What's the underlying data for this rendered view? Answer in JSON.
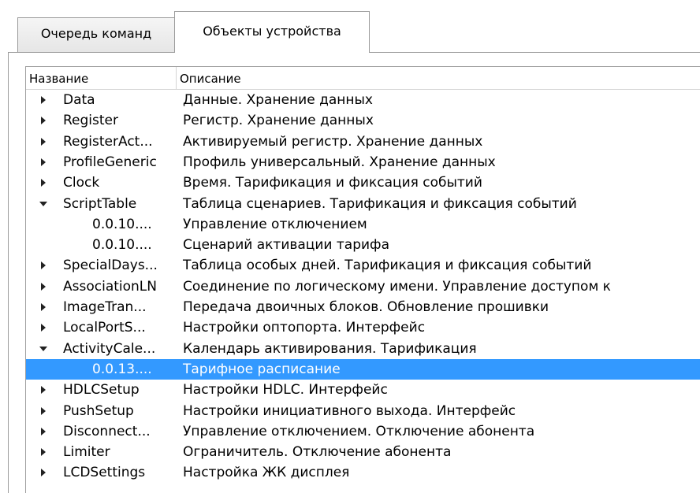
{
  "tabs": {
    "command_queue": "Очередь команд",
    "device_objects": "Объекты устройства"
  },
  "tree": {
    "columns": {
      "name": "Название",
      "description": "Описание"
    },
    "rows": [
      {
        "name": "Data",
        "description": "Данные. Хранение данных",
        "expander": "collapsed",
        "level": 0,
        "selected": false
      },
      {
        "name": "Register",
        "description": "Регистр. Хранение данных",
        "expander": "collapsed",
        "level": 0,
        "selected": false
      },
      {
        "name": "RegisterAct...",
        "description": "Активируемый регистр. Хранение данных",
        "expander": "collapsed",
        "level": 0,
        "selected": false
      },
      {
        "name": "ProfileGeneric",
        "description": "Профиль универсальный. Хранение данных",
        "expander": "collapsed",
        "level": 0,
        "selected": false
      },
      {
        "name": "Clock",
        "description": "Время. Тарификация и фиксация событий",
        "expander": "collapsed",
        "level": 0,
        "selected": false
      },
      {
        "name": "ScriptTable",
        "description": "Таблица сценариев. Тарификация и фиксация событий",
        "expander": "expanded",
        "level": 0,
        "selected": false
      },
      {
        "name": "0.0.10....",
        "description": "Управление отключением",
        "expander": "none",
        "level": 1,
        "selected": false
      },
      {
        "name": "0.0.10....",
        "description": "Сценарий активации тарифа",
        "expander": "none",
        "level": 1,
        "selected": false
      },
      {
        "name": "SpecialDays...",
        "description": "Таблица особых дней. Тарификация и фиксация событий",
        "expander": "collapsed",
        "level": 0,
        "selected": false
      },
      {
        "name": "AssociationLN",
        "description": "Соединение по логическому имени. Управление доступом к",
        "expander": "collapsed",
        "level": 0,
        "selected": false
      },
      {
        "name": "ImageTran...",
        "description": "Передача двоичных блоков. Обновление прошивки",
        "expander": "collapsed",
        "level": 0,
        "selected": false
      },
      {
        "name": "LocalPortS...",
        "description": "Настройки оптопорта. Интерфейс",
        "expander": "collapsed",
        "level": 0,
        "selected": false
      },
      {
        "name": "ActivityCale...",
        "description": "Календарь активирования. Тарификация",
        "expander": "expanded",
        "level": 0,
        "selected": false
      },
      {
        "name": "0.0.13....",
        "description": "Тарифное расписание",
        "expander": "none",
        "level": 1,
        "selected": true
      },
      {
        "name": "HDLCSetup",
        "description": "Настройки HDLC. Интерфейс",
        "expander": "collapsed",
        "level": 0,
        "selected": false
      },
      {
        "name": "PushSetup",
        "description": "Настройки инициативного выхода. Интерфейс",
        "expander": "collapsed",
        "level": 0,
        "selected": false
      },
      {
        "name": "Disconnect...",
        "description": "Управление отключением. Отключение абонента",
        "expander": "collapsed",
        "level": 0,
        "selected": false
      },
      {
        "name": "Limiter",
        "description": "Ограничитель. Отключение абонента",
        "expander": "collapsed",
        "level": 0,
        "selected": false
      },
      {
        "name": "LCDSettings",
        "description": "Настройка ЖК дисплея",
        "expander": "collapsed",
        "level": 0,
        "selected": false
      }
    ]
  }
}
